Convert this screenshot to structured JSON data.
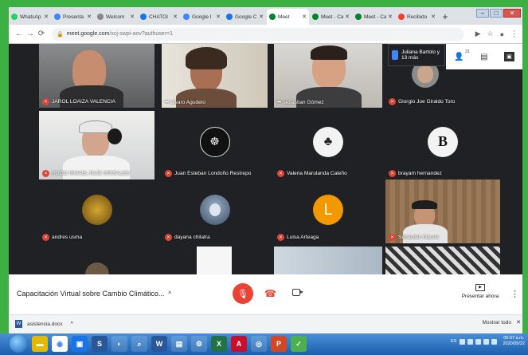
{
  "browser": {
    "tabs": [
      {
        "label": "WhatsAp",
        "icon_color": "#25d366",
        "icon": "whatsapp-icon"
      },
      {
        "label": "Presenta",
        "icon_color": "#4285f4",
        "icon": "slides-icon"
      },
      {
        "label": "Welcom",
        "icon_color": "#888888",
        "icon": "page-icon"
      },
      {
        "label": "CHATOI",
        "icon_color": "#1a73e8",
        "icon": "play-icon"
      },
      {
        "label": "Google I",
        "icon_color": "#4285f4",
        "icon": "search-icon"
      },
      {
        "label": "Google C",
        "icon_color": "#1a73e8",
        "icon": "classroom-icon"
      },
      {
        "label": "Meet",
        "icon_color": "#00832d",
        "icon": "meet-icon",
        "active": true
      },
      {
        "label": "Meet - Ca",
        "icon_color": "#00832d",
        "icon": "meet-icon"
      },
      {
        "label": "Meet - Ca",
        "icon_color": "#00832d",
        "icon": "meet-icon"
      },
      {
        "label": "Recibido",
        "icon_color": "#ea4335",
        "icon": "gmail-icon"
      }
    ],
    "new_tab": "+",
    "url_host": "meet.google.com",
    "url_path": "/xcj-swpi-aov?authuser=1"
  },
  "meet": {
    "participants_label": "Juliana Bartolo y 13 más",
    "participant_count": "31",
    "tiles": [
      {
        "name": "JAROL LOAIZA VALENCIA",
        "muted": true
      },
      {
        "name": "alvaro Agudelo",
        "muted": false
      },
      {
        "name": "sebastian Gómez",
        "muted": false
      },
      {
        "name": "Giorgio Joe Giraldo Toro",
        "muted": true
      },
      {
        "name": "HUGO ISMAEL RUÍZ GRISALES",
        "muted": true
      },
      {
        "name": "Juan Esteban Londoño Restrepo",
        "muted": true
      },
      {
        "name": "Valeria Marulanda Caleño",
        "muted": true
      },
      {
        "name": "brayam hernandez",
        "muted": true
      },
      {
        "name": "andres usma",
        "muted": true
      },
      {
        "name": "dayana chilatra",
        "muted": true
      },
      {
        "name": "Luisa Arteaga",
        "muted": true,
        "initial": "L"
      },
      {
        "name": "Sebastián García",
        "muted": true
      }
    ],
    "meeting_title": "Capacitación Virtual sobre Cambio Climático...",
    "present_label": "Presentar ahora"
  },
  "downloads": {
    "file": "asistencia.docx",
    "show_all": "Mostrar todo"
  },
  "taskbar": {
    "language": "ES",
    "time": "09:07 a.m.",
    "date": "2020/05/22"
  },
  "colors": {
    "frame_green": "#3cb043",
    "meet_bg": "#202124",
    "mute_red": "#ea4335",
    "luisa_orange": "#f29900"
  }
}
